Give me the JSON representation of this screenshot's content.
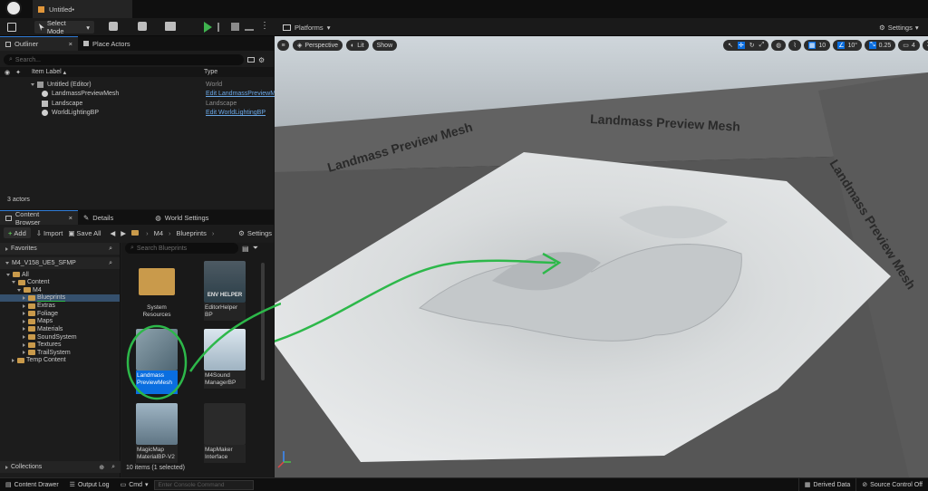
{
  "window": {
    "tab_title": "Untitled•"
  },
  "toolbar": {
    "mode": "Select Mode",
    "platforms": "Platforms",
    "settings": "Settings"
  },
  "outliner": {
    "tab": "Outliner",
    "tab2": "Place Actors",
    "search_placeholder": "Search...",
    "col_label": "Item Label",
    "col_type": "Type",
    "rows": [
      {
        "label": "Untitled (Editor)",
        "type": "World",
        "link": false
      },
      {
        "label": "LandmassPreviewMesh",
        "type": "Edit LandmassPreviewM",
        "link": true
      },
      {
        "label": "Landscape",
        "type": "Landscape",
        "link": false
      },
      {
        "label": "WorldLightingBP",
        "type": "Edit WorldLightingBP",
        "link": true
      }
    ],
    "count": "3 actors"
  },
  "content_browser": {
    "tab": "Content Browser",
    "tab2": "Details",
    "tab3": "World Settings",
    "add": "Add",
    "import": "Import",
    "save_all": "Save All",
    "settings": "Settings",
    "path": [
      "M4",
      "Blueprints"
    ],
    "favorites": "Favorites",
    "root": "M4_V158_UE5_SFMP",
    "search_placeholder": "Search Blueprints",
    "tree": [
      {
        "label": "All",
        "indent": 0
      },
      {
        "label": "Content",
        "indent": 1
      },
      {
        "label": "M4",
        "indent": 2
      },
      {
        "label": "Blueprints",
        "indent": 3
      },
      {
        "label": "Extras",
        "indent": 3
      },
      {
        "label": "Foliage",
        "indent": 3
      },
      {
        "label": "Maps",
        "indent": 3
      },
      {
        "label": "Materials",
        "indent": 3
      },
      {
        "label": "SoundSystem",
        "indent": 3
      },
      {
        "label": "Textures",
        "indent": 3
      },
      {
        "label": "TrailSystem",
        "indent": 3
      },
      {
        "label": "Temp Content",
        "indent": 1
      }
    ],
    "assets": [
      {
        "label": "System Resources"
      },
      {
        "label": "EditorHelper BP",
        "thumb_text": "ENV HELPER"
      },
      {
        "label": "Landmass PreviewMesh"
      },
      {
        "label": "M4Sound ManagerBP"
      },
      {
        "label": "MagicMap MaterialBP-V2"
      },
      {
        "label": "MapMaker Interface"
      }
    ],
    "collections": "Collections",
    "status": "10 items (1 selected)"
  },
  "viewport": {
    "perspective": "Perspective",
    "lit": "Lit",
    "show": "Show",
    "grid": "10",
    "angle": "10°",
    "scale": "0.25",
    "cams": "4",
    "world_text": "Landmass Preview Mesh"
  },
  "statusbar": {
    "content_drawer": "Content Drawer",
    "output_log": "Output Log",
    "cmd": "Cmd",
    "console_placeholder": "Enter Console Command",
    "derived": "Derived Data",
    "source": "Source Control Off"
  },
  "colors": {
    "accent": "#2f7bd6",
    "annotation": "#2db84a",
    "play": "#3fb34f"
  }
}
